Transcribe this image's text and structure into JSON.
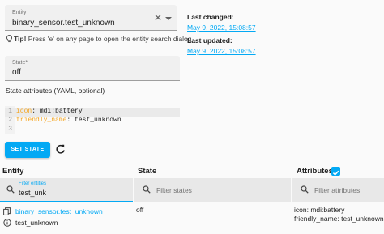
{
  "entity_picker": {
    "label": "Entity",
    "value": "binary_sensor.test_unknown"
  },
  "tip": {
    "bold": "Tip!",
    "text": " Press 'e' on any page to open the entity search dialog"
  },
  "meta": {
    "last_changed_label": "Last changed:",
    "last_changed_value": "May 9, 2022, 15:08:57",
    "last_updated_label": "Last updated:",
    "last_updated_value": "May 9, 2022, 15:08:57"
  },
  "state_field": {
    "label": "State*",
    "value": "off"
  },
  "attributes_title": "State attributes (YAML, optional)",
  "yaml": {
    "lines": [
      {
        "num": "1",
        "key": "icon",
        "value": " mdi:battery"
      },
      {
        "num": "2",
        "key": "friendly_name",
        "value": " test_unknown"
      },
      {
        "num": "3",
        "key": "",
        "value": ""
      }
    ]
  },
  "buttons": {
    "set_state": "SET STATE"
  },
  "table": {
    "headers": {
      "entity": "Entity",
      "state": "State",
      "attributes": "Attributes"
    },
    "filters": {
      "entity_label": "Filter entities",
      "entity_value": "test_unk",
      "states_placeholder": "Filter states",
      "attributes_placeholder": "Filter attributes"
    },
    "row": {
      "entity_id": "binary_sensor.test_unknown",
      "friendly_name": "test_unknown",
      "state": "off",
      "attributes": [
        "icon: mdi:battery",
        "friendly_name: test_unknown"
      ]
    }
  },
  "colors": {
    "accent": "#03a9f4",
    "field_bg": "#f0f0f0",
    "yaml_key": "#f5a623"
  }
}
